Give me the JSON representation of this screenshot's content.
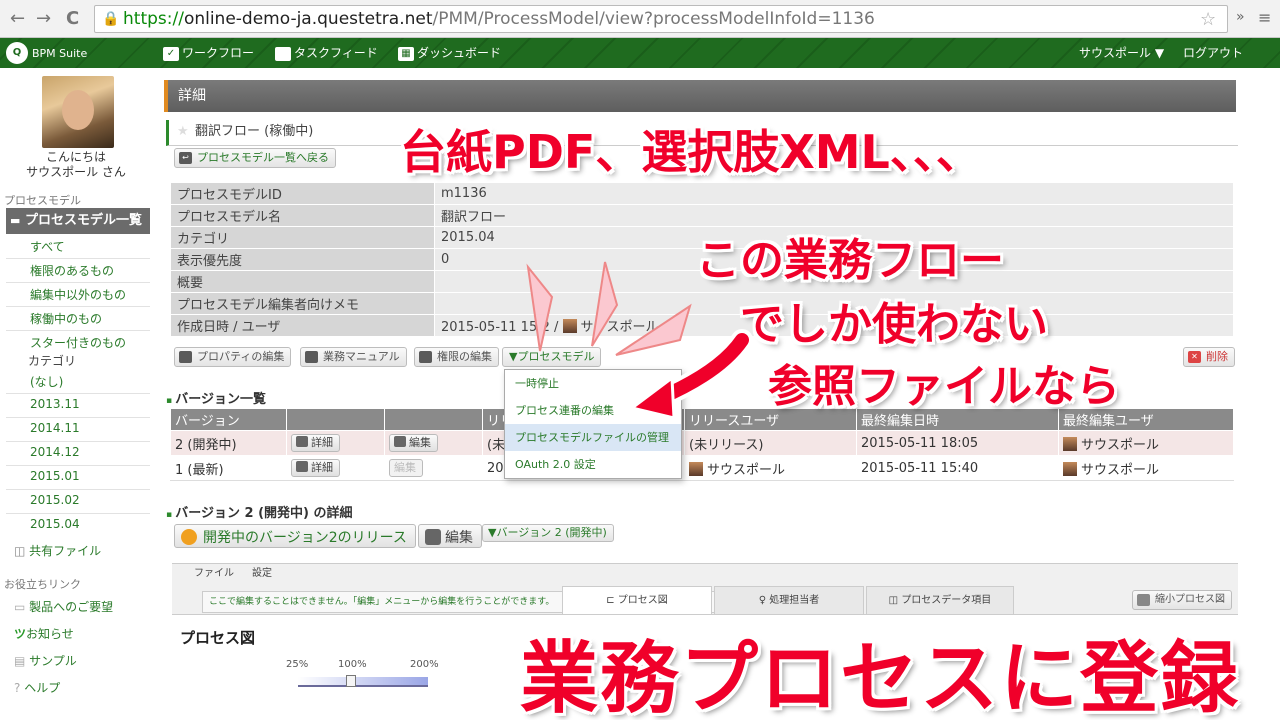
{
  "browser": {
    "back": "←",
    "forward": "→",
    "reload": "C",
    "url_https": "https://",
    "url_host": "online-demo-ja.questetra.net",
    "url_path": "/PMM/ProcessModel/view?processModelInfoId=1136",
    "menu": "»",
    "menu2": "≡"
  },
  "appbar": {
    "logo": "BPM Suite",
    "workflow": "ワークフロー",
    "taskfeed": "タスクフィード",
    "dashboard": "ダッシュボード",
    "user": "サウスポール ▼",
    "logout": "ログアウト"
  },
  "sidebar": {
    "greet1": "こんにちは",
    "greet2": "サウスポール さん",
    "section_pm": "プロセスモデル",
    "pm_list": "プロセスモデル一覧",
    "links": [
      "すべて",
      "権限のあるもの",
      "編集中以外のもの",
      "稼働中のもの",
      "スター付きのもの"
    ],
    "category_label": "カテゴリ",
    "categories": [
      "(なし)",
      "2013.11",
      "2014.11",
      "2014.12",
      "2015.01",
      "2015.02",
      "2015.04"
    ],
    "shared_files": "共有ファイル",
    "useful_links": "お役立ちリンク",
    "useful": [
      "製品へのご要望",
      "お知らせ",
      "サンプル",
      "ヘルプ"
    ]
  },
  "main": {
    "detail": "詳細",
    "flow_title": "翻訳フロー (稼働中)",
    "back_btn": "プロセスモデル一覧へ戻る",
    "props": [
      {
        "k": "プロセスモデルID",
        "v": "m1136"
      },
      {
        "k": "プロセスモデル名",
        "v": "翻訳フロー"
      },
      {
        "k": "カテゴリ",
        "v": "2015.04"
      },
      {
        "k": "表示優先度",
        "v": "0"
      },
      {
        "k": "概要",
        "v": ""
      },
      {
        "k": "プロセスモデル編集者向けメモ",
        "v": ""
      },
      {
        "k": "作成日時 / ユーザ",
        "v": "2015-05-11 15:2",
        "user": "サウスポール"
      }
    ],
    "actions": {
      "properties": "プロパティの編集",
      "manual": "業務マニュアル",
      "perm": "権限の編集",
      "model_menu": "▼プロセスモデル",
      "delete": "削除"
    },
    "dropdown": [
      "一時停止",
      "プロセス連番の編集",
      "プロセスモデルファイルの管理",
      "OAuth 2.0 設定"
    ],
    "versions_title": "バージョン一覧",
    "versions_headers": [
      "バージョン",
      "",
      "",
      "リリ",
      "リリースユーザ",
      "最終編集日時",
      "最終編集ユーザ"
    ],
    "versions": [
      {
        "ver": "2 (開発中)",
        "detail": "詳細",
        "edit": "編集",
        "rel": "(未",
        "rel_user": "(未リリース)",
        "edited": "2015-05-11 18:05",
        "editor": "サウスポール"
      },
      {
        "ver": "1 (最新)",
        "detail": "詳細",
        "edit": "編集",
        "rel": "20",
        "rel_user": "サウスポール",
        "edited": "2015-05-11 15:40",
        "editor": "サウスポール"
      }
    ],
    "v2_title": "バージョン 2 (開発中) の詳細",
    "release_btn": "開発中のバージョン2のリリース",
    "edit_btn": "編集",
    "version_menu": "▼バージョン 2 (開発中)",
    "menu_file": "ファイル",
    "menu_settings": "設定",
    "notice": "ここで編集することはできません。「編集」メニューから編集を行うことができます。",
    "tabs": [
      "プロセス図",
      "処理担当者",
      "プロセスデータ項目"
    ],
    "mini_diagram": "縮小プロセス図",
    "diagram_title": "プロセス図",
    "zoom": [
      "25%",
      "100%",
      "200%"
    ]
  },
  "overlay": {
    "top": "台紙PDF、選択肢XML、、、",
    "mid1": "この業務フロー",
    "mid2": "でしか使わない",
    "mid3": "参照ファイルなら",
    "bottom": "業務プロセスに登録"
  },
  "colors": {
    "app_green": "#1f6b1f",
    "link_green": "#2a7a2a",
    "overlay_red": "#f0002a"
  }
}
